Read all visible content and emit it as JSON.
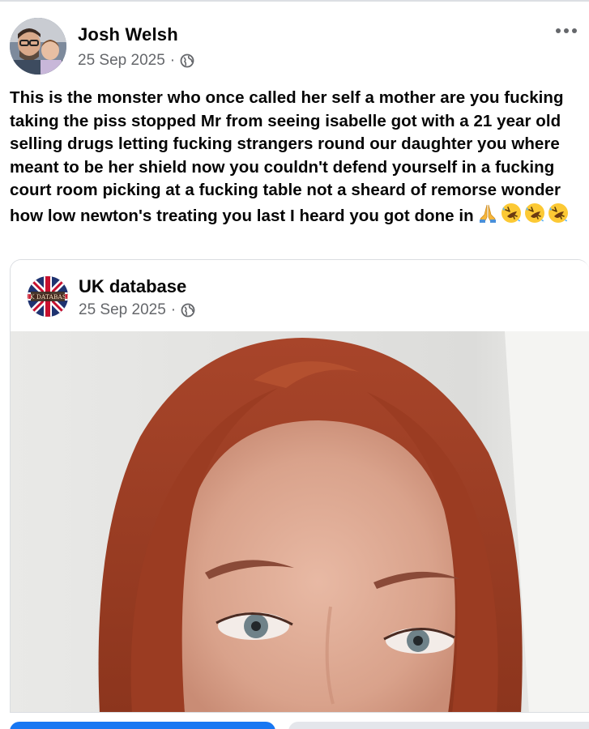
{
  "post": {
    "author": "Josh Welsh",
    "date": "25 Sep 2025",
    "separator": "·",
    "privacy_icon": "globe-icon",
    "more_icon": "more-options-icon",
    "text": "This is the monster who once called her self a mother are you fucking taking the piss stopped Mr from seeing isabelle got with a 21 year old selling drugs letting fucking strangers round our daughter you where meant to be her shield now you couldn't defend yourself in a fucking court room picking at a fucking table not a sheard of remorse wonder how low newton's treating you last I heard you got done in",
    "emojis": [
      "folded-hands-emoji",
      "rolling-on-floor-laughing-emoji",
      "rolling-on-floor-laughing-emoji",
      "rolling-on-floor-laughing-emoji"
    ]
  },
  "shared_post": {
    "page_name": "UK database",
    "logo_text": "UK DATABASE",
    "date": "25 Sep 2025",
    "separator": "·",
    "privacy_icon": "globe-icon"
  },
  "colors": {
    "primary_button": "#1877f2",
    "secondary_button": "#e4e6eb",
    "meta_text": "#65676b"
  }
}
